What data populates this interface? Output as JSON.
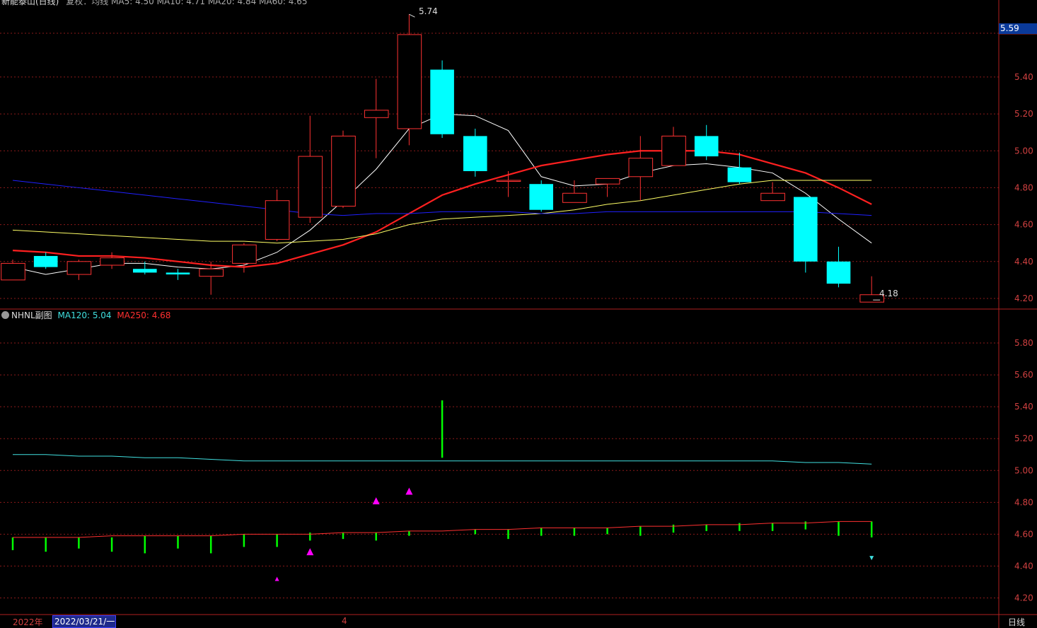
{
  "header": {
    "main_title": "新能泰山(日线)",
    "main_indicators": "复权：均线 MA5: 4.50 MA10: 4.71 MA20: 4.84 MA60: 4.65",
    "sub_title": "NHNL副图",
    "sub_ma120_label": "MA120: 5.04",
    "sub_ma250_label": "MA250: 4.68",
    "current_price_tag": "5.59",
    "high_label": "5.74",
    "low_label": "4.18"
  },
  "footer": {
    "year": "2022年",
    "cursor_date": "2022/03/21/一",
    "month": "4",
    "period": "日线"
  },
  "colors": {
    "up": "#ff3232",
    "down": "#00ffff",
    "ma5": "#ffffff",
    "ma10": "#ff2020",
    "ma20": "#ffff66",
    "ma60": "#2020ff",
    "ma120": "#40e0e0",
    "ma250": "#ff3030",
    "bars": "#00ff00",
    "signal": "#ff00ff",
    "grid": "#8b1a1a",
    "axis_text": "#d04040"
  },
  "chart_data": [
    {
      "type": "candlestick",
      "title": "新能泰山(日线)",
      "ylim": [
        4.15,
        5.76
      ],
      "yticks": [
        "5.40",
        "5.20",
        "5.00",
        "4.80",
        "4.60",
        "4.40",
        "4.20"
      ],
      "candles": [
        {
          "o": 4.3,
          "c": 4.39,
          "h": 4.41,
          "l": 4.3
        },
        {
          "o": 4.43,
          "c": 4.37,
          "h": 4.45,
          "l": 4.36
        },
        {
          "o": 4.33,
          "c": 4.4,
          "h": 4.41,
          "l": 4.3
        },
        {
          "o": 4.38,
          "c": 4.42,
          "h": 4.45,
          "l": 4.36
        },
        {
          "o": 4.36,
          "c": 4.34,
          "h": 4.4,
          "l": 4.33
        },
        {
          "o": 4.34,
          "c": 4.33,
          "h": 4.36,
          "l": 4.3
        },
        {
          "o": 4.32,
          "c": 4.36,
          "h": 4.4,
          "l": 4.22
        },
        {
          "o": 4.39,
          "c": 4.49,
          "h": 4.5,
          "l": 4.34
        },
        {
          "o": 4.52,
          "c": 4.73,
          "h": 4.79,
          "l": 4.51
        },
        {
          "o": 4.64,
          "c": 4.97,
          "h": 5.19,
          "l": 4.61
        },
        {
          "o": 4.7,
          "c": 5.08,
          "h": 5.11,
          "l": 4.69
        },
        {
          "o": 5.18,
          "c": 5.22,
          "h": 5.39,
          "l": 4.96
        },
        {
          "o": 5.12,
          "c": 5.63,
          "h": 5.74,
          "l": 5.03
        },
        {
          "o": 5.44,
          "c": 5.09,
          "h": 5.49,
          "l": 5.07
        },
        {
          "o": 5.08,
          "c": 4.89,
          "h": 5.12,
          "l": 4.86
        },
        {
          "o": 4.84,
          "c": 4.84,
          "h": 4.89,
          "l": 4.75
        },
        {
          "o": 4.82,
          "c": 4.68,
          "h": 4.84,
          "l": 4.67
        },
        {
          "o": 4.72,
          "c": 4.77,
          "h": 4.84,
          "l": 4.72
        },
        {
          "o": 4.82,
          "c": 4.85,
          "h": 4.85,
          "l": 4.75
        },
        {
          "o": 4.86,
          "c": 4.96,
          "h": 5.08,
          "l": 4.73
        },
        {
          "o": 4.92,
          "c": 5.08,
          "h": 5.13,
          "l": 4.92
        },
        {
          "o": 5.08,
          "c": 4.97,
          "h": 5.14,
          "l": 4.95
        },
        {
          "o": 4.91,
          "c": 4.83,
          "h": 4.99,
          "l": 4.82
        },
        {
          "o": 4.73,
          "c": 4.77,
          "h": 4.83,
          "l": 4.73
        },
        {
          "o": 4.75,
          "c": 4.4,
          "h": 4.75,
          "l": 4.34
        },
        {
          "o": 4.4,
          "c": 4.28,
          "h": 4.48,
          "l": 4.26
        },
        {
          "o": 4.18,
          "c": 4.22,
          "h": 4.32,
          "l": 4.18
        }
      ],
      "series": [
        {
          "name": "MA5",
          "values": [
            4.37,
            4.33,
            4.36,
            4.39,
            4.39,
            4.37,
            4.36,
            4.38,
            4.45,
            4.57,
            4.73,
            4.9,
            5.12,
            5.2,
            5.19,
            5.11,
            4.86,
            4.81,
            4.82,
            4.88,
            4.92,
            4.93,
            4.91,
            4.88,
            4.77,
            4.63,
            4.5
          ]
        },
        {
          "name": "MA10",
          "values": [
            4.46,
            4.45,
            4.43,
            4.43,
            4.42,
            4.4,
            4.38,
            4.37,
            4.39,
            4.44,
            4.49,
            4.56,
            4.66,
            4.76,
            4.82,
            4.87,
            4.92,
            4.95,
            4.98,
            5.0,
            5.0,
            5.0,
            4.98,
            4.93,
            4.88,
            4.8,
            4.71
          ]
        },
        {
          "name": "MA20",
          "values": [
            4.57,
            4.56,
            4.55,
            4.54,
            4.53,
            4.52,
            4.51,
            4.51,
            4.5,
            4.51,
            4.52,
            4.55,
            4.6,
            4.63,
            4.64,
            4.65,
            4.66,
            4.68,
            4.71,
            4.73,
            4.76,
            4.79,
            4.82,
            4.84,
            4.84,
            4.84,
            4.84
          ]
        },
        {
          "name": "MA60",
          "values": [
            4.84,
            4.82,
            4.8,
            4.78,
            4.76,
            4.74,
            4.72,
            4.7,
            4.68,
            4.66,
            4.65,
            4.66,
            4.66,
            4.67,
            4.67,
            4.67,
            4.66,
            4.66,
            4.67,
            4.67,
            4.67,
            4.67,
            4.67,
            4.67,
            4.67,
            4.66,
            4.65
          ]
        }
      ]
    },
    {
      "type": "bar",
      "title": "NHNL副图",
      "ylim": [
        4.1,
        6.0
      ],
      "yticks": [
        "5.80",
        "5.60",
        "5.40",
        "5.20",
        "5.00",
        "4.80",
        "4.60",
        "4.40",
        "4.20"
      ],
      "bars": [
        {
          "top": 4.58,
          "bottom": 4.5
        },
        {
          "top": 4.58,
          "bottom": 4.49
        },
        {
          "top": 4.58,
          "bottom": 4.51
        },
        {
          "top": 4.58,
          "bottom": 4.49
        },
        {
          "top": 4.59,
          "bottom": 4.48
        },
        {
          "top": 4.59,
          "bottom": 4.51
        },
        {
          "top": 4.59,
          "bottom": 4.48
        },
        {
          "top": 4.6,
          "bottom": 4.52
        },
        {
          "top": 4.6,
          "bottom": 4.52
        },
        {
          "top": 4.61,
          "bottom": 4.56
        },
        {
          "top": 4.61,
          "bottom": 4.57
        },
        {
          "top": 4.61,
          "bottom": 4.56
        },
        {
          "top": 4.62,
          "bottom": 4.59
        },
        {
          "top": 5.44,
          "bottom": 5.08
        },
        {
          "top": 4.63,
          "bottom": 4.6
        },
        {
          "top": 4.63,
          "bottom": 4.57
        },
        {
          "top": 4.64,
          "bottom": 4.59
        },
        {
          "top": 4.64,
          "bottom": 4.59
        },
        {
          "top": 4.64,
          "bottom": 4.6
        },
        {
          "top": 4.65,
          "bottom": 4.59
        },
        {
          "top": 4.66,
          "bottom": 4.61
        },
        {
          "top": 4.66,
          "bottom": 4.62
        },
        {
          "top": 4.67,
          "bottom": 4.62
        },
        {
          "top": 4.67,
          "bottom": 4.62
        },
        {
          "top": 4.68,
          "bottom": 4.63
        },
        {
          "top": 4.68,
          "bottom": 4.59
        },
        {
          "top": 4.68,
          "bottom": 4.58
        }
      ],
      "series": [
        {
          "name": "MA120",
          "values": [
            5.1,
            5.1,
            5.09,
            5.09,
            5.08,
            5.08,
            5.07,
            5.06,
            5.06,
            5.06,
            5.06,
            5.06,
            5.06,
            5.06,
            5.06,
            5.06,
            5.06,
            5.06,
            5.06,
            5.06,
            5.06,
            5.06,
            5.06,
            5.06,
            5.05,
            5.05,
            5.04
          ]
        },
        {
          "name": "MA250",
          "values": [
            4.58,
            4.58,
            4.58,
            4.59,
            4.59,
            4.59,
            4.59,
            4.6,
            4.6,
            4.6,
            4.61,
            4.61,
            4.62,
            4.62,
            4.63,
            4.63,
            4.64,
            4.64,
            4.64,
            4.65,
            4.65,
            4.66,
            4.66,
            4.67,
            4.67,
            4.68,
            4.68
          ]
        }
      ],
      "markers": [
        {
          "index": 8,
          "y": 4.32,
          "shape": "up-small"
        },
        {
          "index": 9,
          "y": 4.49,
          "shape": "up"
        },
        {
          "index": 11,
          "y": 4.81,
          "shape": "up"
        },
        {
          "index": 12,
          "y": 4.87,
          "shape": "up"
        },
        {
          "index": 26,
          "y": 4.45,
          "shape": "down-small"
        }
      ]
    }
  ]
}
